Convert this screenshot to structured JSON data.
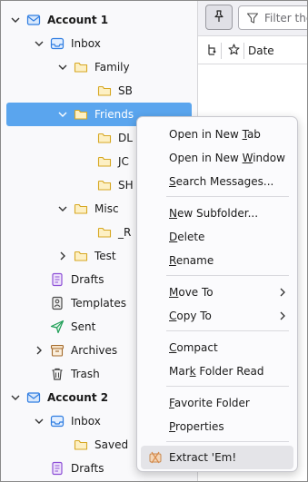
{
  "folders": [
    {
      "label": "Account 1",
      "bold": true,
      "twisty": "down",
      "icon": "account-icon"
    },
    {
      "label": "Inbox",
      "twisty": "down",
      "icon": "inbox-icon"
    },
    {
      "label": "Family",
      "twisty": "down",
      "icon": "folder-icon"
    },
    {
      "label": "SB",
      "icon": "folder-icon"
    },
    {
      "label": "Friends",
      "twisty": "down",
      "icon": "folder-icon",
      "selected": true
    },
    {
      "label": "DL",
      "icon": "folder-icon"
    },
    {
      "label": "JC",
      "icon": "folder-icon"
    },
    {
      "label": "SH",
      "icon": "folder-icon"
    },
    {
      "label": "Misc",
      "twisty": "down",
      "icon": "folder-icon"
    },
    {
      "label": "_R",
      "icon": "folder-icon"
    },
    {
      "label": "Test",
      "twisty": "right",
      "icon": "folder-icon"
    },
    {
      "label": "Drafts",
      "icon": "drafts-icon"
    },
    {
      "label": "Templates",
      "icon": "templates-icon"
    },
    {
      "label": "Sent",
      "icon": "sent-icon"
    },
    {
      "label": "Archives",
      "twisty": "right",
      "icon": "archive-icon"
    },
    {
      "label": "Trash",
      "icon": "trash-icon"
    },
    {
      "label": "Account 2",
      "bold": true,
      "twisty": "down",
      "icon": "account-icon"
    },
    {
      "label": "Inbox",
      "twisty": "down",
      "icon": "inbox-icon"
    },
    {
      "label": "Saved",
      "icon": "folder-icon"
    },
    {
      "label": "Drafts",
      "icon": "drafts-icon"
    }
  ],
  "search": {
    "placeholder": "Filter these messages"
  },
  "columns": {
    "date": "Date"
  },
  "menu": {
    "open_new_tab": {
      "pre": "Open in New ",
      "acc": "T",
      "post": "ab"
    },
    "open_new_window": {
      "pre": "Open in New ",
      "acc": "W",
      "post": "indow"
    },
    "search_messages": {
      "pre": "",
      "acc": "S",
      "post": "earch Messages..."
    },
    "new_subfolder": {
      "pre": "",
      "acc": "N",
      "post": "ew Subfolder..."
    },
    "delete": {
      "pre": "",
      "acc": "D",
      "post": "elete"
    },
    "rename": {
      "pre": "",
      "acc": "R",
      "post": "ename"
    },
    "move_to": {
      "pre": "",
      "acc": "M",
      "post": "ove To"
    },
    "copy_to": {
      "pre": "",
      "acc": "C",
      "post": "opy To"
    },
    "compact": {
      "pre": "",
      "acc": "C",
      "post": "ompact"
    },
    "mark_read": {
      "pre": "Mar",
      "acc": "k",
      "post": " Folder Read"
    },
    "favorite": {
      "pre": "",
      "acc": "F",
      "post": "avorite Folder"
    },
    "properties": {
      "pre": "",
      "acc": "P",
      "post": "roperties"
    },
    "extract": {
      "pre": "Extract 'Em!",
      "acc": "",
      "post": ""
    }
  },
  "colors": {
    "selection": "#5aa5ee",
    "folder": "#f5cf5b",
    "account": "#2f7de1",
    "drafts": "#8d4fd6",
    "sent": "#1f9e57"
  }
}
